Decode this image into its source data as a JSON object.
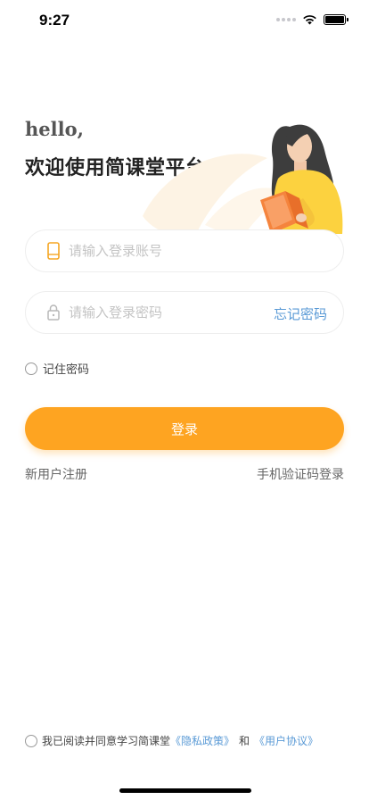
{
  "status_bar": {
    "time": "9:27"
  },
  "hero": {
    "hello": "hello,",
    "title": "欢迎使用简课堂平台"
  },
  "login_form": {
    "account_placeholder": "请输入登录账号",
    "account_value": "",
    "password_placeholder": "请输入登录密码",
    "password_value": "",
    "forgot_password": "忘记密码",
    "remember_password": "记住密码",
    "remember_checked": false,
    "login_button": "登录"
  },
  "links": {
    "register": "新用户注册",
    "sms_login": "手机验证码登录"
  },
  "agreement": {
    "prefix": "我已阅读并同意学习简课堂",
    "privacy": "《隐私政策》",
    "conjunction": "和",
    "terms": "《用户协议》",
    "checked": false
  },
  "colors": {
    "primary": "#fea421",
    "link": "#5a9ad6",
    "input_icon": "#f5a623"
  }
}
